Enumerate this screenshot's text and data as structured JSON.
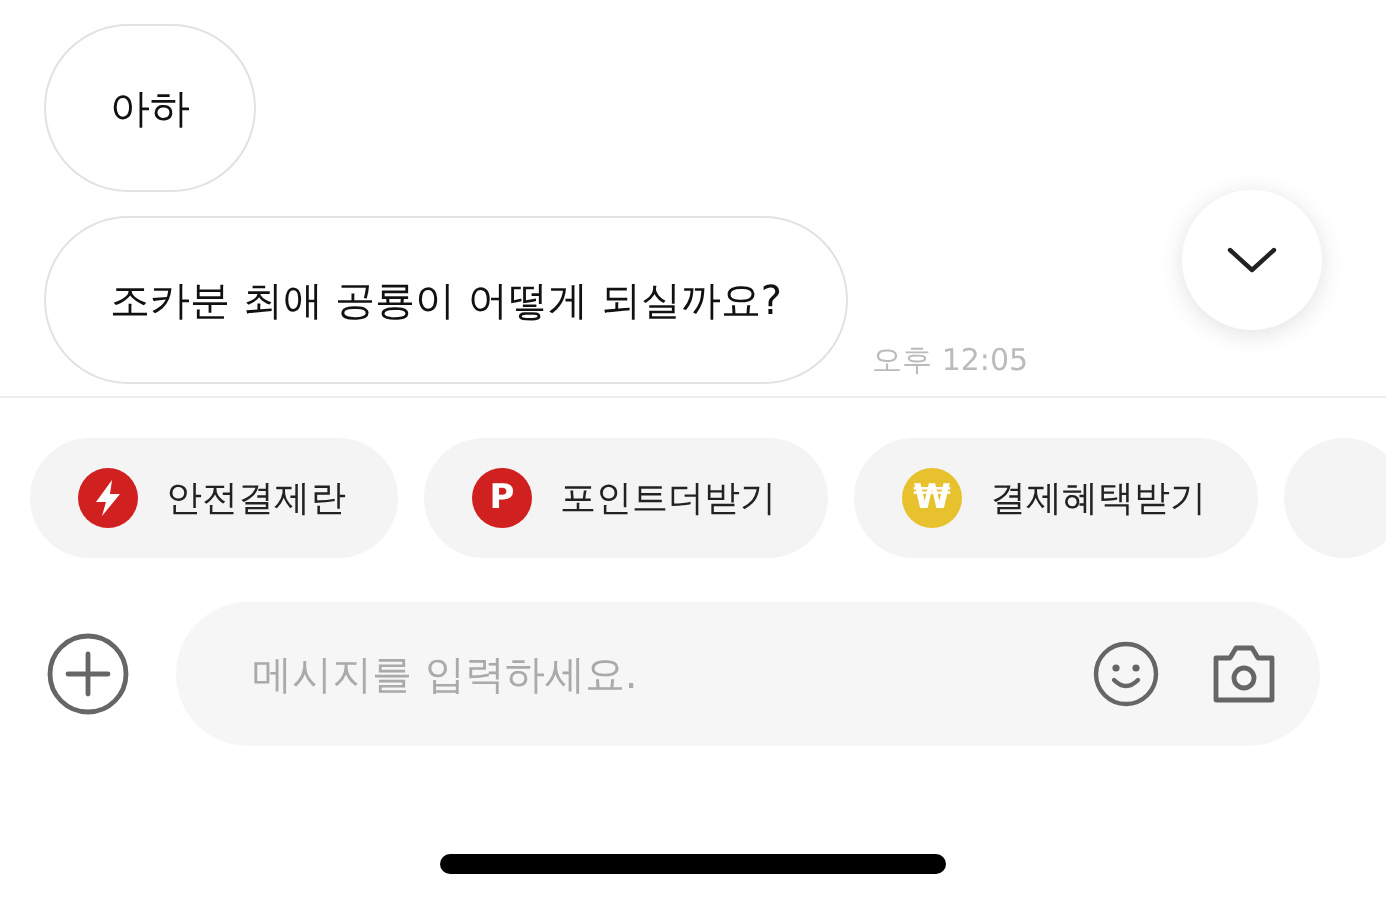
{
  "messages": [
    {
      "text": "아하"
    },
    {
      "text": "조카분 최애 공룡이 어떻게 되실까요?"
    }
  ],
  "timestamp": "오후 12:05",
  "quick_actions": [
    {
      "kind": "lightning",
      "label": "안전결제란",
      "color": "#d0201f"
    },
    {
      "kind": "letter",
      "badge": "P",
      "label": "포인트더받기",
      "color": "#d0201f"
    },
    {
      "kind": "letter",
      "badge": "₩",
      "label": "결제혜택받기",
      "color": "#e8c22e"
    }
  ],
  "composer": {
    "placeholder": "메시지를 입력하세요."
  }
}
